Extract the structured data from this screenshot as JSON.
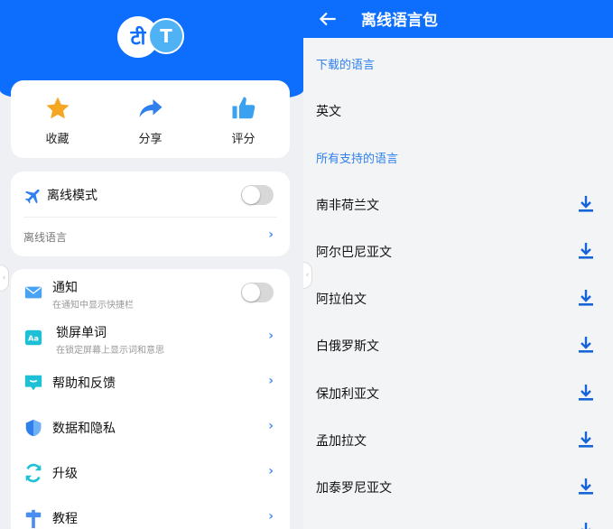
{
  "logo": {
    "left_glyph": "टी",
    "right_glyph": "T"
  },
  "quick_actions": [
    {
      "label": "收藏",
      "icon": "star-icon"
    },
    {
      "label": "分享",
      "icon": "share-arrow-icon"
    },
    {
      "label": "评分",
      "icon": "thumbs-up-icon"
    }
  ],
  "offline": {
    "mode_label": "离线模式",
    "language_label": "离线语言",
    "mode_enabled": false
  },
  "settings": [
    {
      "title": "通知",
      "subtitle": "在通知中显示快捷栏",
      "icon": "mail-icon",
      "control": "toggle",
      "enabled": false
    },
    {
      "title": "锁屏单词",
      "subtitle": "在锁定屏幕上显示词和意思",
      "icon": "aa-icon",
      "control": "chevron"
    },
    {
      "title": "帮助和反馈",
      "subtitle": "",
      "icon": "chat-icon",
      "control": "chevron"
    },
    {
      "title": "数据和隐私",
      "subtitle": "",
      "icon": "shield-icon",
      "control": "chevron"
    },
    {
      "title": "升级",
      "subtitle": "",
      "icon": "refresh-icon",
      "control": "chevron"
    },
    {
      "title": "教程",
      "subtitle": "",
      "icon": "signpost-icon",
      "control": "chevron"
    }
  ],
  "chevron_glyph": "›",
  "handle_glyph": "‹",
  "right": {
    "title": "离线语言包",
    "downloaded_header": "下载的语言",
    "downloaded": [
      "英文"
    ],
    "supported_header": "所有支持的语言",
    "supported": [
      "南非荷兰文",
      "阿尔巴尼亚文",
      "阿拉伯文",
      "白俄罗斯文",
      "保加利亚文",
      "孟加拉文",
      "加泰罗尼亚文"
    ]
  },
  "colors": {
    "brand_blue": "#0d6efd",
    "accent": "#2f80ed",
    "star": "#f5a623",
    "cyan": "#1ec0d6"
  }
}
